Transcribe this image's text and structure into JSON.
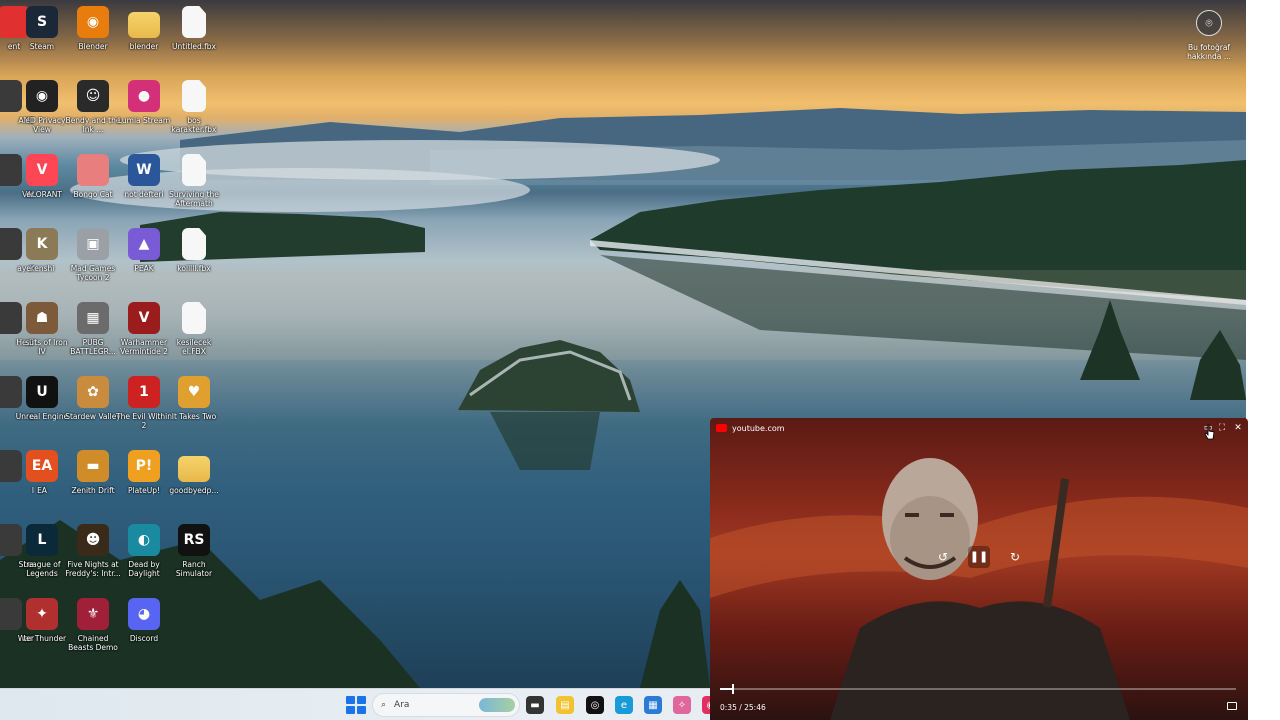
{
  "desktop_icons": [
    {
      "label": "ent",
      "glyph": "",
      "color": "#e03030"
    },
    {
      "label": "Steam",
      "glyph": "S",
      "color": "#1b2838"
    },
    {
      "label": "Blender",
      "glyph": "◉",
      "color": "#e87d0d"
    },
    {
      "label": "blender",
      "glyph": "",
      "color": "folder"
    },
    {
      "label": "Untitled.fbx",
      "glyph": "",
      "color": "file"
    },
    {
      "label": "AMD Privacy View",
      "glyph": "◉",
      "color": "#222222"
    },
    {
      "label": "Bendy and the Ink ...",
      "glyph": "☺",
      "color": "#2a2a2a"
    },
    {
      "label": "Lumia Stream",
      "glyph": "●",
      "color": "#d4307a"
    },
    {
      "label": "boş karakter.fbx",
      "glyph": "",
      "color": "file"
    },
    {
      "label": "VALORANT",
      "glyph": "V",
      "color": "#ff4655"
    },
    {
      "label": "Bongo Cat",
      "glyph": "",
      "color": "#e97e7e"
    },
    {
      "label": "not defteri",
      "glyph": "W",
      "color": "#2b579a"
    },
    {
      "label": "Surviving the Aftermath",
      "glyph": "",
      "color": "file"
    },
    {
      "label": "Kenshi",
      "glyph": "K",
      "color": "#8a7a55"
    },
    {
      "label": "Mad Games Tycoon 2",
      "glyph": "▣",
      "color": "#9aa0a6"
    },
    {
      "label": "PEAK",
      "glyph": "▲",
      "color": "#7a5bd6"
    },
    {
      "label": "kolllll.fbx",
      "glyph": "",
      "color": "file"
    },
    {
      "label": "Hearts of Iron IV",
      "glyph": "☗",
      "color": "#7d5a3a"
    },
    {
      "label": "PUBG BATTLEGR...",
      "glyph": "▦",
      "color": "#6b6b6b"
    },
    {
      "label": "Warhammer Vermintide 2",
      "glyph": "V",
      "color": "#9a1c1c"
    },
    {
      "label": "kesilecek el.FBX",
      "glyph": "",
      "color": "file"
    },
    {
      "label": "Unreal Engine",
      "glyph": "U",
      "color": "#111111"
    },
    {
      "label": "Stardew Valley",
      "glyph": "✿",
      "color": "#c98b3e"
    },
    {
      "label": "The Evil Within 2",
      "glyph": "1",
      "color": "#cc2222"
    },
    {
      "label": "It Takes Two",
      "glyph": "♥",
      "color": "#e0a030"
    },
    {
      "label": "EA",
      "glyph": "EA",
      "color": "#e34f1f"
    },
    {
      "label": "Zenith Drift",
      "glyph": "▬",
      "color": "#d18c2a"
    },
    {
      "label": "PlateUp!",
      "glyph": "P!",
      "color": "#f0a020"
    },
    {
      "label": "goodbyedp...",
      "glyph": "",
      "color": "folder"
    },
    {
      "label": "League of Legends",
      "glyph": "L",
      "color": "#0a2a3a"
    },
    {
      "label": "Five Nights at Freddy's: Intr...",
      "glyph": "☻",
      "color": "#3a2a1a"
    },
    {
      "label": "Dead by Daylight",
      "glyph": "◐",
      "color": "#1a8aa0"
    },
    {
      "label": "Ranch Simulator",
      "glyph": "RS",
      "color": "#111111"
    },
    {
      "label": "War Thunder",
      "glyph": "✦",
      "color": "#b03030"
    },
    {
      "label": "Chained Beasts Demo",
      "glyph": "⚜",
      "color": "#a0203a"
    },
    {
      "label": "Discord",
      "glyph": "◕",
      "color": "#5865f2"
    }
  ],
  "left_cut_labels": [
    "ent",
    "ell",
    "er",
    "ayer",
    "sü",
    "e",
    "l",
    "Stra",
    "ter"
  ],
  "photo_info": {
    "label": "Bu fotoğraf hakkında ..."
  },
  "taskbar": {
    "search_placeholder": "Ara",
    "apps": [
      {
        "name": "file-explorer",
        "glyph": "▬",
        "color": "#333333"
      },
      {
        "name": "files",
        "glyph": "▤",
        "color": "#f2c230"
      },
      {
        "name": "chatgpt",
        "glyph": "◎",
        "color": "#111111"
      },
      {
        "name": "edge",
        "glyph": "e",
        "color": "#1a9ad6"
      },
      {
        "name": "store",
        "glyph": "▦",
        "color": "#2a7ad6"
      },
      {
        "name": "copilot",
        "glyph": "✧",
        "color": "#e0679b"
      },
      {
        "name": "app",
        "glyph": "◉",
        "color": "#e03060"
      }
    ]
  },
  "pip": {
    "source": "youtube.com",
    "time_current": "0:35",
    "time_total": "25:46",
    "time_text": "0:35 / 25:46",
    "progress": 0.023
  }
}
